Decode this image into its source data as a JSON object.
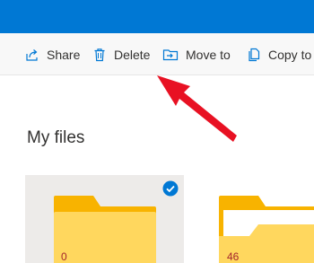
{
  "toolbar": {
    "share_label": "Share",
    "delete_label": "Delete",
    "move_label": "Move to",
    "copy_label": "Copy to"
  },
  "page": {
    "title": "My files"
  },
  "folders": [
    {
      "count": "0",
      "selected": true
    },
    {
      "count": "46",
      "selected": false
    }
  ],
  "colors": {
    "accent": "#0078d4",
    "folder": "#ffd75e",
    "folder_back": "#f8b300",
    "annotation_arrow": "#e81123"
  },
  "icons": [
    "share-icon",
    "delete-icon",
    "move-to-icon",
    "copy-to-icon",
    "checkmark-icon",
    "folder-icon"
  ]
}
